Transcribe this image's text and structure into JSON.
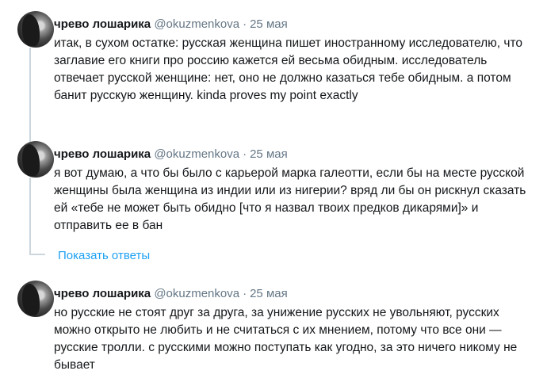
{
  "tweets": [
    {
      "name": "чрево лошарика",
      "handle": "@okuzmenkova",
      "date": "25 мая",
      "text": "итак, в сухом остатке: русская женщина пишет иностранному исследователю, что заглавие его книги про россию кажется ей весьма обидным. исследователь отвечает русской женщине: нет, оно не должно казаться тебе обидным. а потом банит русскую женщину. kinda proves my point exactly"
    },
    {
      "name": "чрево лошарика",
      "handle": "@okuzmenkova",
      "date": "25 мая",
      "text": "я вот думаю, а что бы было с карьерой марка галеотти, если бы на месте русской женщины была женщина из индии или из нигерии? вряд ли бы он рискнул сказать ей «тебе не может быть обидно [что я назвал твоих предков дикарями]» и отправить ее в бан"
    },
    {
      "name": "чрево лошарика",
      "handle": "@okuzmenkova",
      "date": "25 мая",
      "text": "но русские не стоят друг за друга, за унижение русских не увольняют, русских можно открыто не любить и не считаться с их мнением, потому что все они — русские тролли. с русскими можно поступать как угодно, за это ничего никому не бывает"
    }
  ],
  "show_replies_label": "Показать ответы"
}
